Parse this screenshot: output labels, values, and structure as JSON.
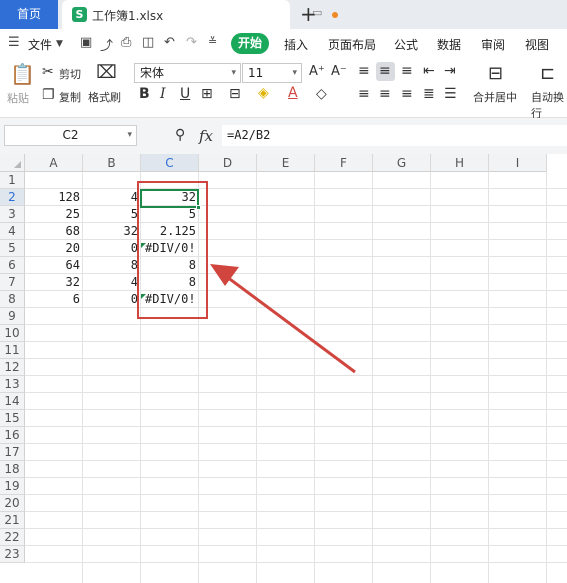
{
  "tabs": {
    "home": "首页",
    "doc_icon": "S",
    "doc_title": "工作簿1.xlsx",
    "plus": "+"
  },
  "menu": {
    "file": "文件",
    "items": [
      "开始",
      "插入",
      "页面布局",
      "公式",
      "数据",
      "审阅",
      "视图"
    ]
  },
  "ribbon": {
    "paste": "粘贴",
    "cut": "剪切",
    "copy": "复制",
    "format_painter": "格式刷",
    "font_name": "宋体",
    "font_size": "11",
    "bold": "B",
    "italic": "I",
    "underline": "U",
    "merge_center": "合并居中",
    "wrap": "自动换行"
  },
  "formula_bar": {
    "name_box": "C2",
    "fx": "fx",
    "formula": "=A2/B2"
  },
  "sheet": {
    "columns": [
      "A",
      "B",
      "C",
      "D",
      "E",
      "F",
      "G",
      "H",
      "I"
    ],
    "rows": [
      "1",
      "2",
      "3",
      "4",
      "5",
      "6",
      "7",
      "8",
      "9",
      "10",
      "11",
      "12",
      "13",
      "14",
      "15",
      "16",
      "17",
      "18",
      "19",
      "20",
      "21",
      "22",
      "23"
    ],
    "selected_column": "C",
    "selected_row": "2",
    "data": [
      {
        "row": "2",
        "a": "128",
        "b": "4",
        "c": "32"
      },
      {
        "row": "3",
        "a": "25",
        "b": "5",
        "c": "5"
      },
      {
        "row": "4",
        "a": "68",
        "b": "32",
        "c": "2.125"
      },
      {
        "row": "5",
        "a": "20",
        "b": "0",
        "c": "#DIV/0!"
      },
      {
        "row": "6",
        "a": "64",
        "b": "8",
        "c": "8"
      },
      {
        "row": "7",
        "a": "32",
        "b": "4",
        "c": "8"
      },
      {
        "row": "8",
        "a": "6",
        "b": "0",
        "c": "#DIV/0!"
      }
    ]
  },
  "colors": {
    "accent_green": "#1aa85b",
    "home_tab_blue": "#2f6fd6",
    "annotation_red": "#d0463f"
  }
}
